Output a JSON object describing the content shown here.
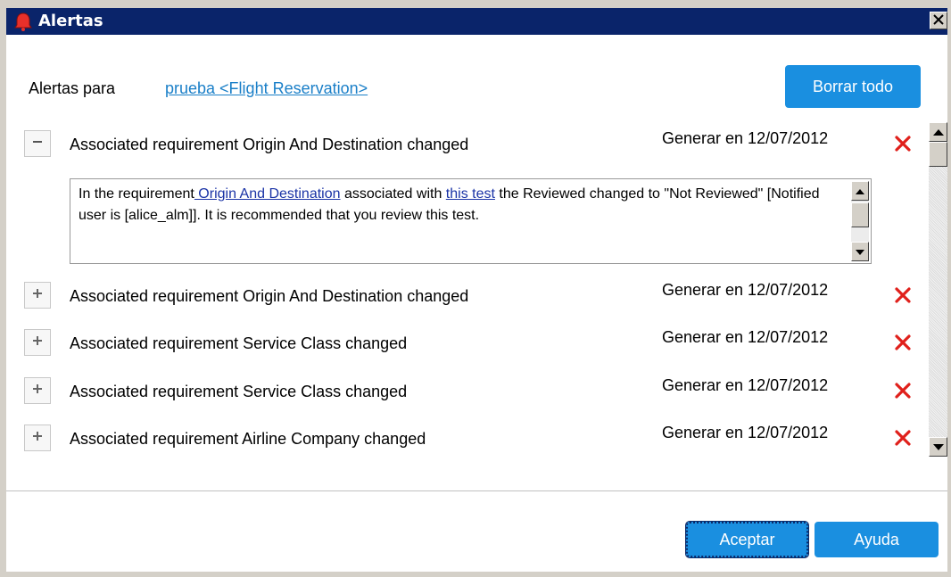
{
  "window": {
    "title": "Alertas",
    "close_icon": "close-icon"
  },
  "header": {
    "alerts_for_label": "Alertas para",
    "alerts_for_link": "prueba <Flight Reservation>",
    "clear_all_label": "Borrar todo"
  },
  "alerts": [
    {
      "title": "Associated requirement Origin And Destination changed",
      "date": "Generar en 12/07/2012",
      "expanded": true,
      "toggle_icon": "minus",
      "details": {
        "prefix": "In the requirement",
        "link1": " Origin And Destination",
        "middle": " associated with ",
        "link2": "this test",
        "suffix": " the Reviewed changed to \"Not Reviewed\" [Notified user is [alice_alm]]. It is recommended that you review this test."
      }
    },
    {
      "title": "Associated requirement Origin And Destination changed",
      "date": "Generar en 12/07/2012",
      "expanded": false,
      "toggle_icon": "plus"
    },
    {
      "title": "Associated requirement Service Class changed",
      "date": "Generar en 12/07/2012",
      "expanded": false,
      "toggle_icon": "plus"
    },
    {
      "title": "Associated requirement Service Class changed",
      "date": "Generar en 12/07/2012",
      "expanded": false,
      "toggle_icon": "plus"
    },
    {
      "title": "Associated requirement Airline Company changed",
      "date": "Generar en 12/07/2012",
      "expanded": false,
      "toggle_icon": "plus"
    }
  ],
  "footer": {
    "ok_label": "Aceptar",
    "help_label": "Ayuda"
  },
  "colors": {
    "titlebar": "#0a246a",
    "accent_button": "#1a8fe0",
    "link": "#1a7fc8",
    "delete": "#e0201b"
  }
}
